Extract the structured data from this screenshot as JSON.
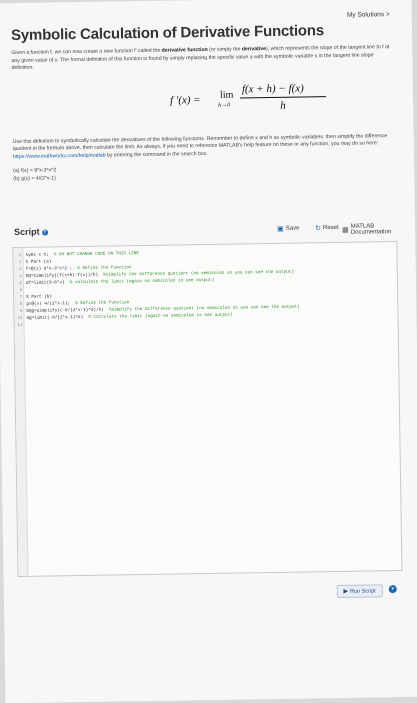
{
  "header": {
    "my_solutions": "My Solutions >",
    "title": "Symbolic Calculation of Derivative Functions"
  },
  "intro": {
    "text_a": "Given a function f, we can now create a new function f' called the ",
    "bold_a": "derivative function",
    "text_b": " (or simply the ",
    "bold_b": "derivative",
    "text_c": "), which represents the slope of the tangent line to f at any given value of x. The formal definition of this function is found by simply replacing the specific value a with the symbolic variable x in the tangent line slope definition:"
  },
  "formula": {
    "lhs": "f ′(x) =",
    "lim": "lim",
    "lim_sub": "h→0",
    "numerator": "f(x + h) − f(x)",
    "denominator": "h"
  },
  "instructions": {
    "text": "Use this definition to symbolically calculate the derivatives of the following functions. Remember to define x and h as symbolic variables, then simplify the difference quotient in the formula above, then calculate the limit. As always, if you need to reference MATLAB's help feature on these or any function, you may do so here:",
    "link": "https://www.mathworks.com/help/matlab",
    "link_suffix": " by entering the command in the search box.",
    "part_a": "(a) f(x) = 8*x-3*x^2",
    "part_b": "(b) g(x) = 4/(2*x-1)"
  },
  "script": {
    "label": "Script",
    "save": "Save",
    "reset": "Reset",
    "doc": "MATLAB Documentation",
    "lines": [
      {
        "n": "1",
        "code": "syms x h;  ",
        "comment": "% DO NOT CHANGE CODE ON THIS LINE"
      },
      {
        "n": "2",
        "code": "% Part (a)",
        "comment": ""
      },
      {
        "n": "3",
        "code": "f=@(x) 8*x-3*x^2 ;  ",
        "comment": "% Define the function"
      },
      {
        "n": "4",
        "code": "DQ=simplify((f(x+h)-f(x))/h)  ",
        "comment": "%simplify the difference quotient (no semicolon so you can see the output)"
      },
      {
        "n": "5",
        "code": "df=limit(8-6*x)  ",
        "comment": "% calculate the limit (again no semicolon to see output)"
      },
      {
        "n": "6",
        "code": "",
        "comment": ""
      },
      {
        "n": "7",
        "code": "% Part (b)",
        "comment": ""
      },
      {
        "n": "8",
        "code": "g=@(x) 4/(2*x-1);  ",
        "comment": "% Define the function"
      },
      {
        "n": "9",
        "code": "DQg=simplify((-8/(2*x-1)^2)/h)  ",
        "comment": "%simplify the difference quotient (no semicolon so you can see the output)"
      },
      {
        "n": "10",
        "code": "dg=limit(-8/(2*x-1)^2)  ",
        "comment": "% calculate the limit (again no semicolon to see output)"
      },
      {
        "n": "11",
        "code": "",
        "comment": ""
      }
    ]
  },
  "run": {
    "label": "Run Script"
  }
}
